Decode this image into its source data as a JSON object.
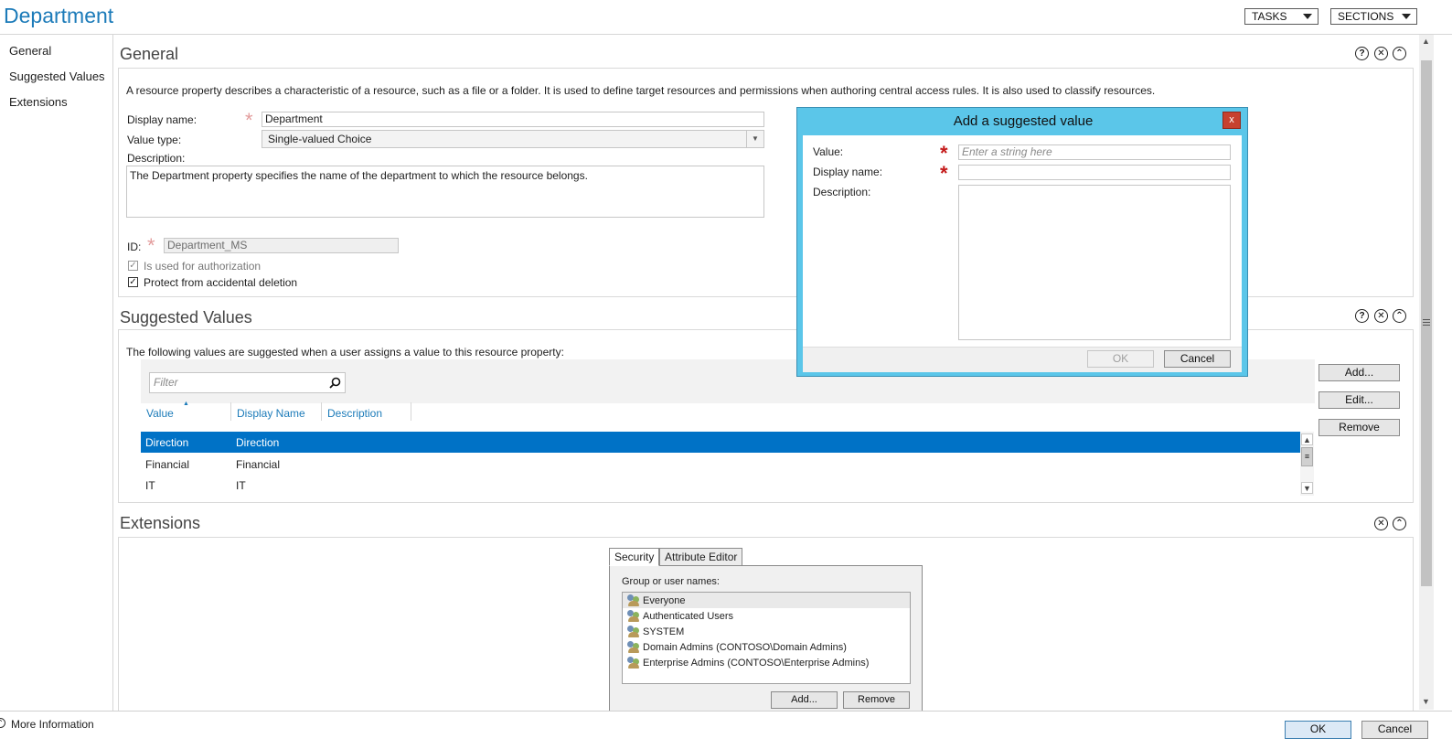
{
  "window": {
    "title": "Department"
  },
  "header": {
    "tasks_label": "TASKS",
    "sections_label": "SECTIONS"
  },
  "sidebar": {
    "items": [
      {
        "label": "General"
      },
      {
        "label": "Suggested Values"
      },
      {
        "label": "Extensions"
      }
    ]
  },
  "general": {
    "title": "General",
    "description_text": "A resource property describes a characteristic of a resource, such as a file or a folder. It is used to define target resources and permissions when authoring central access rules. It is also used to classify resources.",
    "display_name_label": "Display name:",
    "display_name_value": "Department",
    "value_type_label": "Value type:",
    "value_type_value": "Single-valued Choice",
    "description_label": "Description:",
    "description_value": "The Department property specifies the name of the department to which  the resource belongs.",
    "id_label": "ID:",
    "id_value": "Department_MS",
    "authorization_label": "Is used for authorization",
    "protect_label": "Protect from accidental deletion"
  },
  "suggested": {
    "title": "Suggested Values",
    "intro": "The following values are suggested when a user assigns a value to this resource property:",
    "filter_placeholder": "Filter",
    "columns": [
      "Value",
      "Display Name",
      "Description"
    ],
    "rows": [
      {
        "value": "Direction",
        "display": "Direction"
      },
      {
        "value": "Financial",
        "display": "Financial"
      },
      {
        "value": "IT",
        "display": "IT"
      }
    ],
    "add_label": "Add...",
    "edit_label": "Edit...",
    "remove_label": "Remove"
  },
  "extensions": {
    "title": "Extensions",
    "tabs": [
      "Security",
      "Attribute Editor"
    ],
    "group_label": "Group or user names:",
    "users": [
      "Everyone",
      "Authenticated Users",
      "SYSTEM",
      "Domain Admins (CONTOSO\\Domain Admins)",
      "Enterprise Admins (CONTOSO\\Enterprise Admins)"
    ],
    "add_label": "Add...",
    "remove_label": "Remove"
  },
  "dialog": {
    "title": "Add a suggested value",
    "close_label": "x",
    "value_label": "Value:",
    "value_placeholder": "Enter a string here",
    "display_name_label": "Display name:",
    "description_label": "Description:",
    "ok_label": "OK",
    "cancel_label": "Cancel"
  },
  "footer": {
    "more_info": "More Information",
    "ok_label": "OK",
    "cancel_label": "Cancel"
  },
  "colors": {
    "accent": "#1c7bb9",
    "selection": "#0072c6",
    "dialog_frame": "#5bc6e9",
    "close_red": "#c7412f"
  }
}
